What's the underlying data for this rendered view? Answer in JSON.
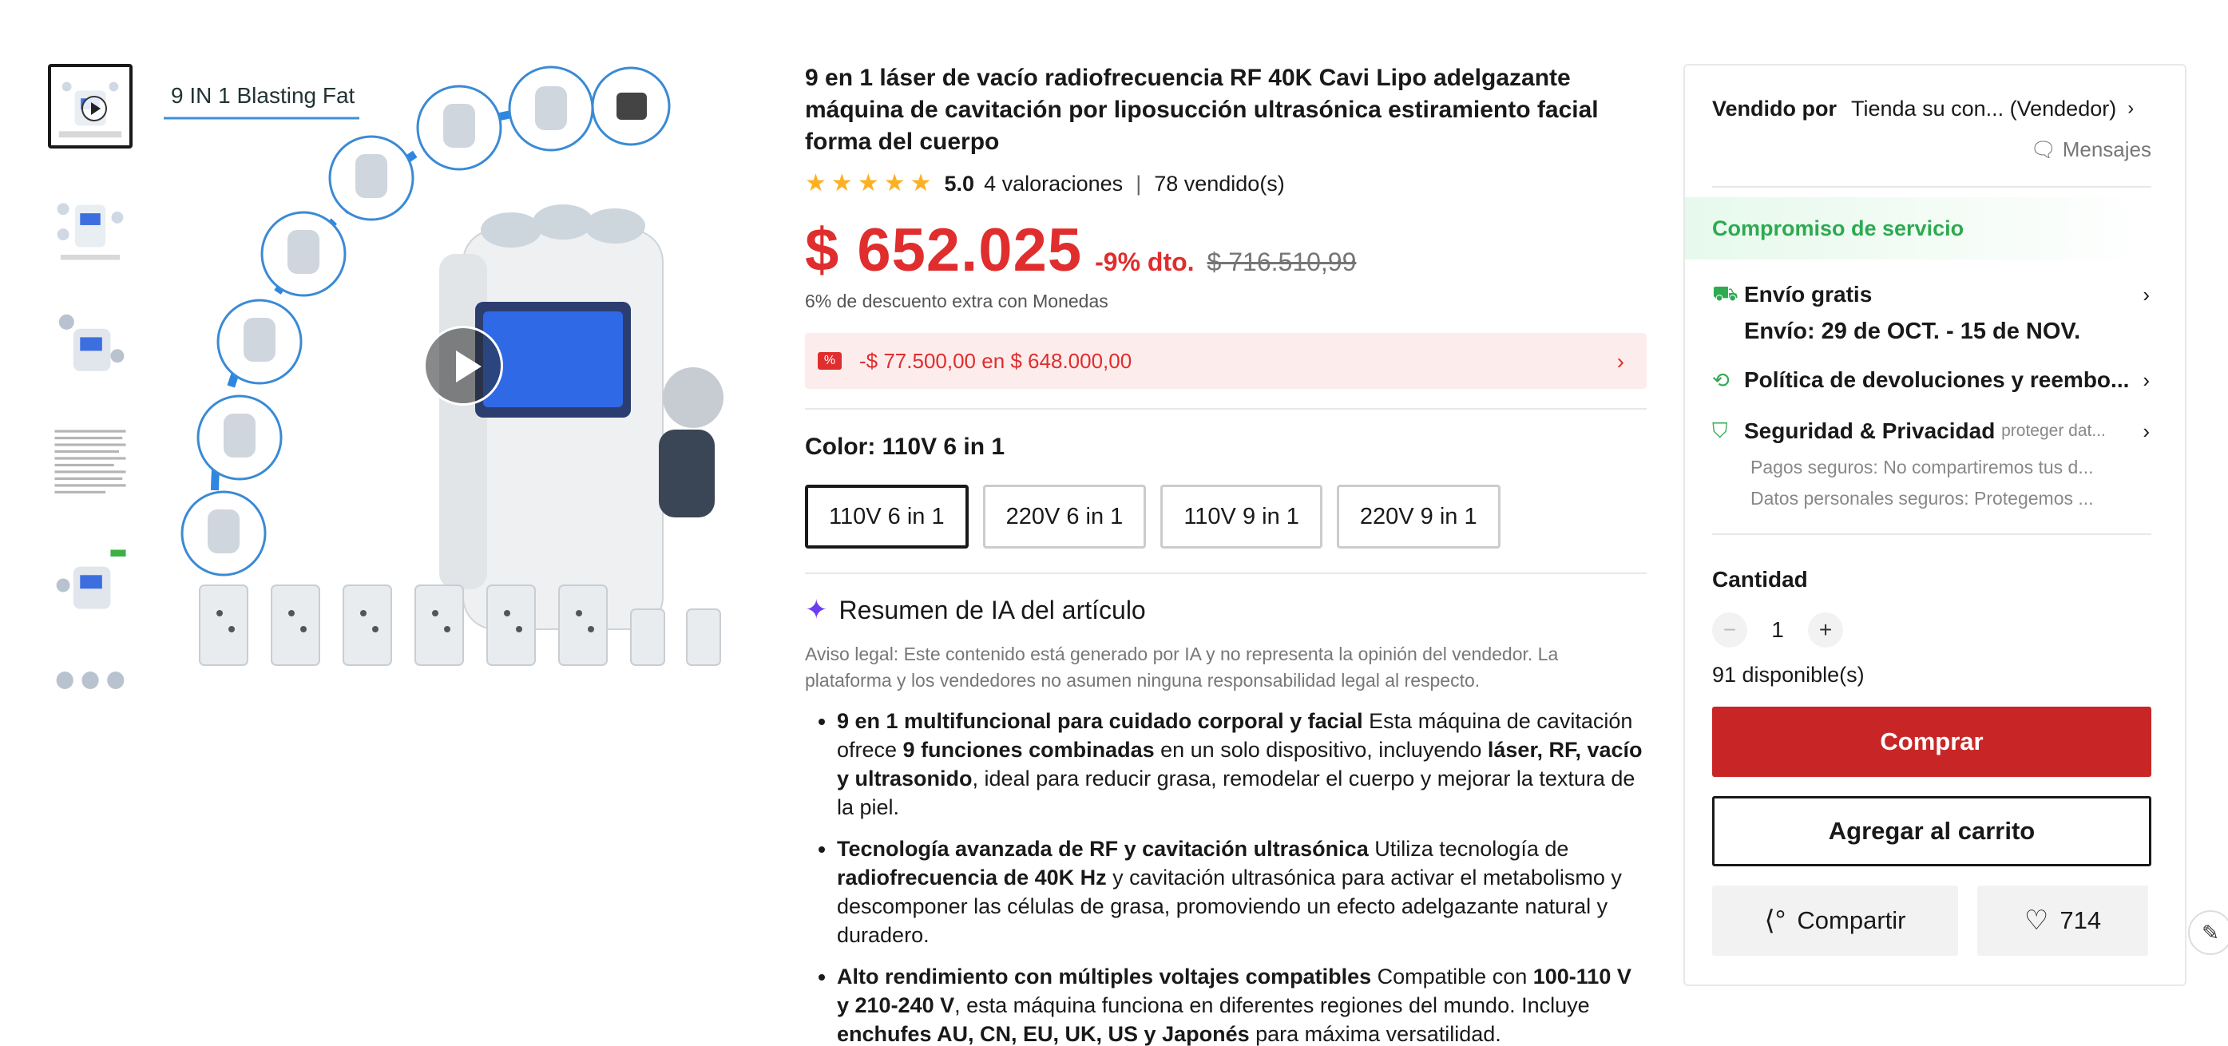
{
  "gallery": {
    "thumbnails": [
      "thumb-1",
      "thumb-2",
      "thumb-3",
      "thumb-4",
      "thumb-5",
      "thumb-6"
    ],
    "main_image_caption": "9 IN 1 Blasting Fat"
  },
  "product": {
    "title": "9 en 1 láser de vacío radiofrecuencia RF 40K Cavi Lipo adelgazante máquina de cavitación por liposucción ultrasónica estiramiento facial forma del cuerpo",
    "rating": "5.0",
    "reviews": "4 valoraciones",
    "sold": "78 vendido(s)",
    "price": "$ 652.025",
    "discount": "-9% dto.",
    "original_price": "$ 716.510,99",
    "coins_note": "6% de descuento extra con Monedas",
    "coupon": "-$ 77.500,00 en $ 648.000,00",
    "color_label": "Color:",
    "color_value": "110V 6 in 1",
    "options": [
      "110V 6 in 1",
      "220V 6 in 1",
      "110V 9 in 1",
      "220V 9 in 1"
    ]
  },
  "ai_summary": {
    "title": "Resumen de IA del artículo",
    "legal": "Aviso legal: Este contenido está generado por IA y no representa la opinión del vendedor. La plataforma y los vendedores no asumen ninguna responsabilidad legal al respecto.",
    "bullets": [
      {
        "parts": [
          {
            "b": true,
            "t": "9 en 1 multifuncional para cuidado corporal y facial"
          },
          {
            "b": false,
            "t": " Esta máquina de cavitación ofrece "
          },
          {
            "b": true,
            "t": "9 funciones combinadas"
          },
          {
            "b": false,
            "t": " en un solo dispositivo, incluyendo "
          },
          {
            "b": true,
            "t": "láser, RF, vacío y ultrasonido"
          },
          {
            "b": false,
            "t": ", ideal para reducir grasa, remodelar el cuerpo y mejorar la textura de la piel."
          }
        ]
      },
      {
        "parts": [
          {
            "b": true,
            "t": "Tecnología avanzada de RF y cavitación ultrasónica"
          },
          {
            "b": false,
            "t": " Utiliza tecnología de "
          },
          {
            "b": true,
            "t": "radiofrecuencia de 40K Hz"
          },
          {
            "b": false,
            "t": " y cavitación ultrasónica para activar el metabolismo y descomponer las células de grasa, promoviendo un efecto adelgazante natural y duradero."
          }
        ]
      },
      {
        "parts": [
          {
            "b": true,
            "t": "Alto rendimiento con múltiples voltajes compatibles"
          },
          {
            "b": false,
            "t": " Compatible con "
          },
          {
            "b": true,
            "t": "100-110 V y 210-240 V"
          },
          {
            "b": false,
            "t": ", esta máquina funciona en diferentes regiones del mundo. Incluye "
          },
          {
            "b": true,
            "t": "enchufes AU, CN, EU, UK, US y Japonés"
          },
          {
            "b": false,
            "t": " para máxima versatilidad."
          }
        ]
      }
    ]
  },
  "seller": {
    "label": "Vendido por",
    "name": "Tienda su con... (Vendedor)",
    "messages": "Mensajes"
  },
  "service": {
    "title": "Compromiso de servicio",
    "shipping_title": "Envío gratis",
    "shipping_date": "Envío: 29 de OCT. - 15 de NOV.",
    "returns": "Política de devoluciones y reembo...",
    "security_title": "Seguridad & Privacidad",
    "security_small": "proteger dat...",
    "security_line1": "Pagos seguros: No compartiremos tus d...",
    "security_line2": "Datos personales seguros: Protegemos ..."
  },
  "purchase": {
    "qty_label": "Cantidad",
    "qty": "1",
    "available": "91 disponible(s)",
    "buy": "Comprar",
    "cart": "Agregar al carrito",
    "share": "Compartir",
    "wishlist_count": "714"
  },
  "colors": {
    "accent": "#c82626",
    "price_red": "#e02d2d",
    "green": "#2eaa51",
    "ai_purple": "#6b3cf0"
  },
  "icons": [
    "play-icon",
    "star-icon",
    "coupon-icon",
    "chevron-right-icon",
    "sparkle-icon",
    "message-icon",
    "truck-icon",
    "return-icon",
    "shield-icon",
    "minus-icon",
    "plus-icon",
    "share-icon",
    "heart-icon",
    "edit-icon"
  ]
}
